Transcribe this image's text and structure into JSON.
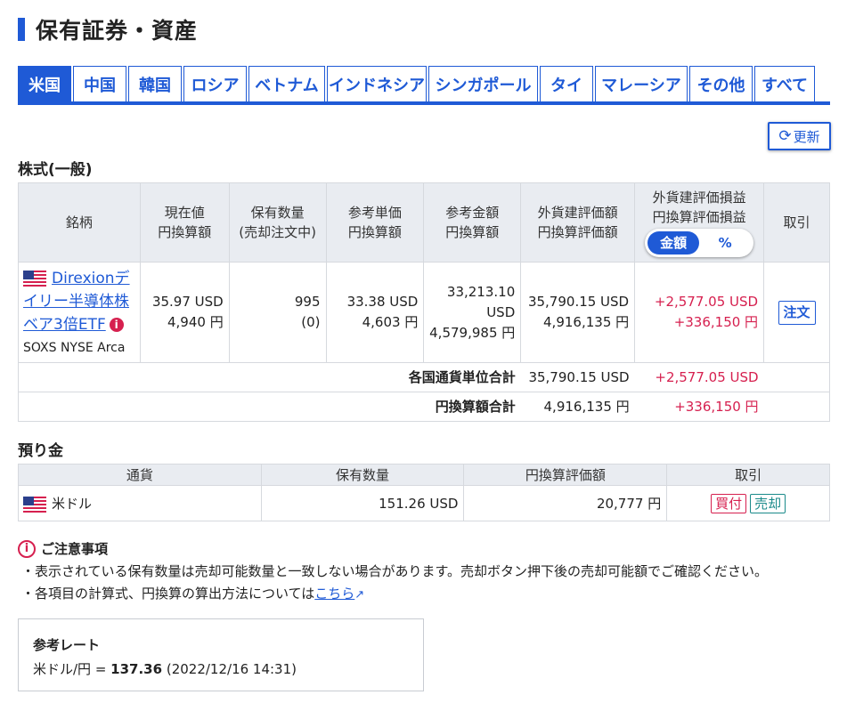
{
  "page_title": "保有証券・資産",
  "tabs": [
    "米国",
    "中国",
    "韓国",
    "ロシア",
    "ベトナム",
    "インドネシア",
    "シンガポール",
    "タイ",
    "マレーシア",
    "その他",
    "すべて"
  ],
  "active_tab": "米国",
  "refresh_label": "更新",
  "stock_section": {
    "title": "株式(一般)",
    "headers": {
      "name": "銘柄",
      "price_1": "現在値",
      "price_2": "円換算額",
      "qty_1": "保有数量",
      "qty_2": "(売却注文中)",
      "unit_1": "参考単価",
      "unit_2": "円換算額",
      "amount_1": "参考金額",
      "amount_2": "円換算額",
      "val_1": "外貨建評価額",
      "val_2": "円換算評価額",
      "pl_1": "外貨建評価損益",
      "pl_2": "円換算評価損益",
      "toggle_amount": "金額",
      "toggle_percent": "%",
      "trade": "取引"
    },
    "row": {
      "name": "Direxionデイリー半導体株ベア3倍ETF",
      "ticker_market": "SOXS  NYSE Arca",
      "price_usd": "35.97 USD",
      "price_jpy": "4,940 円",
      "qty": "995",
      "qty_selling": "(0)",
      "unit_usd": "33.38 USD",
      "unit_jpy": "4,603 円",
      "amount_usd_1": "33,213.10",
      "amount_usd_2": "USD",
      "amount_jpy": "4,579,985 円",
      "val_usd": "35,790.15 USD",
      "val_jpy": "4,916,135 円",
      "pl_usd": "+2,577.05 USD",
      "pl_jpy": "+336,150 円",
      "order_label": "注文"
    },
    "totals": {
      "currency_label": "各国通貨単位合計",
      "currency_val": "35,790.15 USD",
      "currency_pl": "+2,577.05 USD",
      "jpy_label": "円換算額合計",
      "jpy_val": "4,916,135 円",
      "jpy_pl": "+336,150 円"
    }
  },
  "deposit_section": {
    "title": "預り金",
    "headers": {
      "currency": "通貨",
      "qty": "保有数量",
      "jpy": "円換算評価額",
      "trade": "取引"
    },
    "row": {
      "currency": "米ドル",
      "qty": "151.26 USD",
      "jpy": "20,777 円",
      "buy_label": "買付",
      "sell_label": "売却"
    }
  },
  "notes": {
    "title": "ご注意事項",
    "line1": "・表示されている保有数量は売却可能数量と一致しない場合があります。売却ボタン押下後の売却可能額でご確認ください。",
    "line2_prefix": "・各項目の計算式、円換算の算出方法については",
    "line2_link": "こちら"
  },
  "rate": {
    "title": "参考レート",
    "label": "米ドル/円 = ",
    "value": "137.36",
    "timestamp": "(2022/12/16 14:31)"
  },
  "colors": {
    "accent": "#1f5ad6",
    "positive": "#d6204f",
    "header_bg": "#e9ecf1"
  }
}
